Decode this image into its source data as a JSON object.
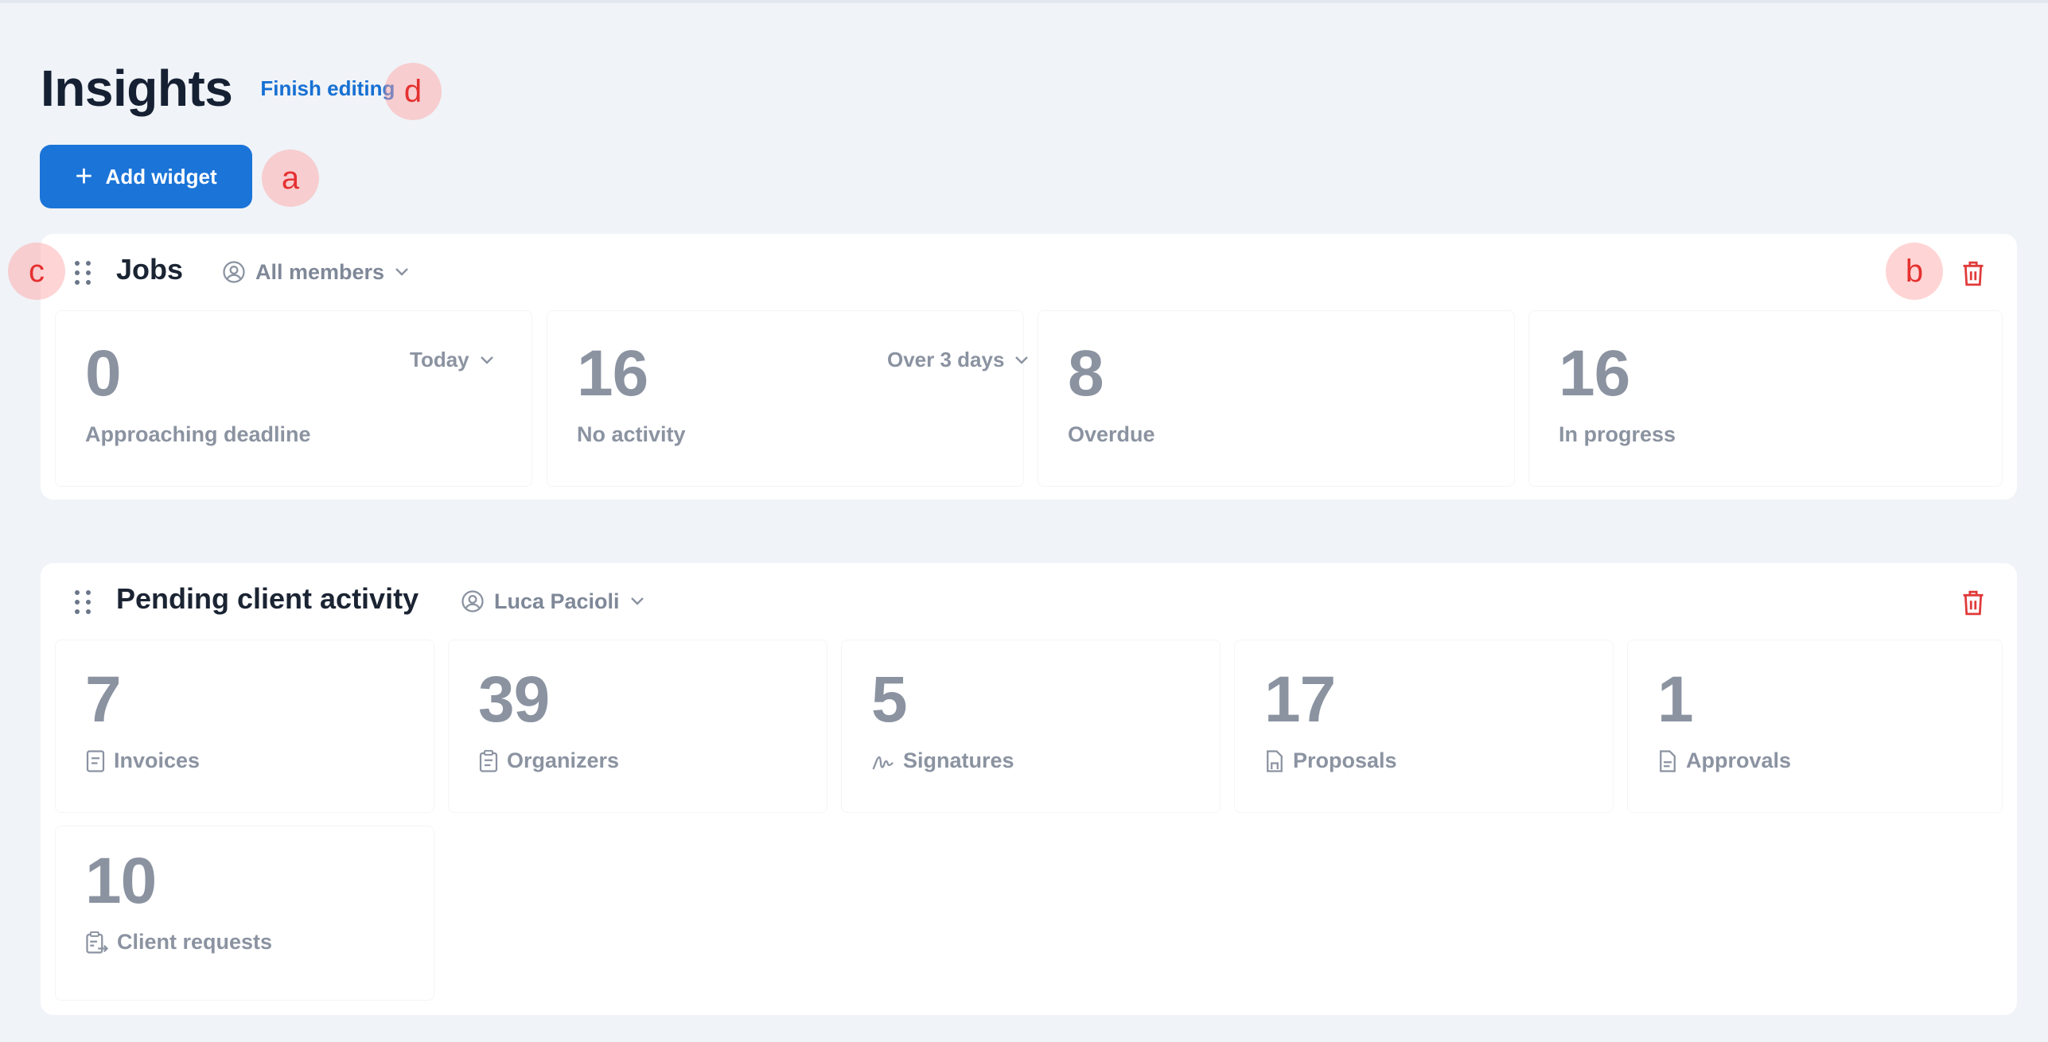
{
  "page": {
    "title": "Insights",
    "finish_editing": "Finish editing"
  },
  "toolbar": {
    "add_widget": "Add widget",
    "add_icon": "+"
  },
  "markers": {
    "a": "a",
    "b": "b",
    "c": "c",
    "d": "d"
  },
  "jobs_widget": {
    "title": "Jobs",
    "member_filter": "All members",
    "stats": [
      {
        "value": "0",
        "label": "Approaching deadline",
        "period": "Today"
      },
      {
        "value": "16",
        "label": "No activity",
        "period": "Over 3 days"
      },
      {
        "value": "8",
        "label": "Overdue"
      },
      {
        "value": "16",
        "label": "In progress"
      }
    ]
  },
  "client_widget": {
    "title": "Pending client activity",
    "member_filter": "Luca Pacioli",
    "stats": [
      {
        "value": "7",
        "label": "Invoices",
        "icon": "invoice-icon"
      },
      {
        "value": "39",
        "label": "Organizers",
        "icon": "clipboard-icon"
      },
      {
        "value": "5",
        "label": "Signatures",
        "icon": "signature-icon"
      },
      {
        "value": "17",
        "label": "Proposals",
        "icon": "proposal-icon"
      },
      {
        "value": "1",
        "label": "Approvals",
        "icon": "document-icon"
      },
      {
        "value": "10",
        "label": "Client requests",
        "icon": "client-request-icon"
      }
    ]
  },
  "colors": {
    "accent": "#1b74d8",
    "link": "#1670d3",
    "danger": "#e03a3a",
    "muted": "#8b93a1",
    "background": "#f0f3f7"
  }
}
